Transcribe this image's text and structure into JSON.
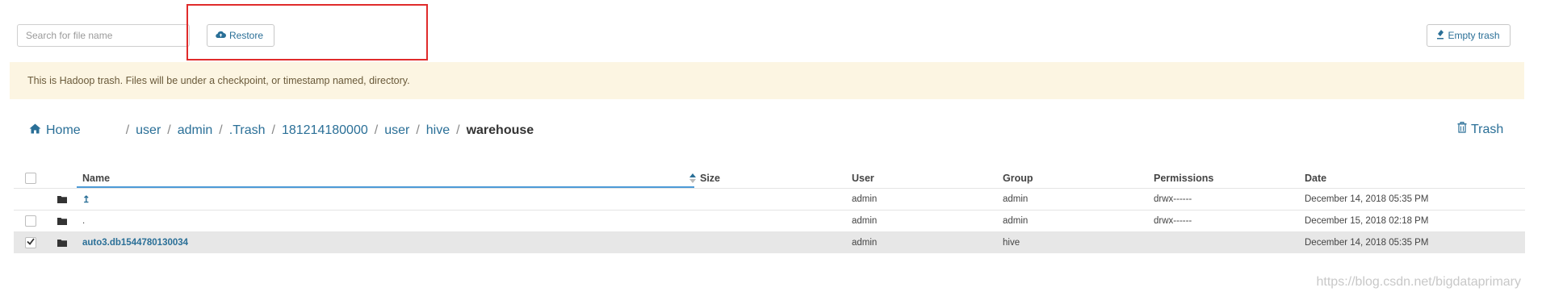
{
  "toolbar": {
    "search_placeholder": "Search for file name",
    "restore_label": "Restore",
    "empty_trash_label": "Empty trash"
  },
  "banner": {
    "text": "This is Hadoop trash. Files will be under a checkpoint, or timestamp named, directory."
  },
  "breadcrumb": {
    "home": "Home",
    "parts": [
      "user",
      "admin",
      ".Trash",
      "181214180000",
      "user",
      "hive"
    ],
    "current": "warehouse",
    "separator": "/",
    "trash_link": "Trash"
  },
  "table": {
    "headers": {
      "name": "Name",
      "size": "Size",
      "user": "User",
      "group": "Group",
      "permissions": "Permissions",
      "date": "Date"
    },
    "rows": [
      {
        "name": "↥",
        "size": "",
        "user": "admin",
        "group": "admin",
        "permissions": "drwx------",
        "date": "December 14, 2018 05:35 PM",
        "checked": false,
        "has_checkbox": false
      },
      {
        "name": ".",
        "size": "",
        "user": "admin",
        "group": "admin",
        "permissions": "drwx------",
        "date": "December 15, 2018 02:18 PM",
        "checked": false,
        "has_checkbox": true
      },
      {
        "name": "auto3.db1544780130034",
        "size": "",
        "user": "admin",
        "group": "hive",
        "permissions": "",
        "date": "December 14, 2018 05:35 PM",
        "checked": true,
        "has_checkbox": true
      }
    ]
  },
  "watermark": "https://blog.csdn.net/bigdataprimary",
  "colors": {
    "link": "#2a6f97",
    "banner_bg": "#fcf5e2",
    "highlight_border": "#e02b2b",
    "selected_row_bg": "#e7e7e7"
  }
}
